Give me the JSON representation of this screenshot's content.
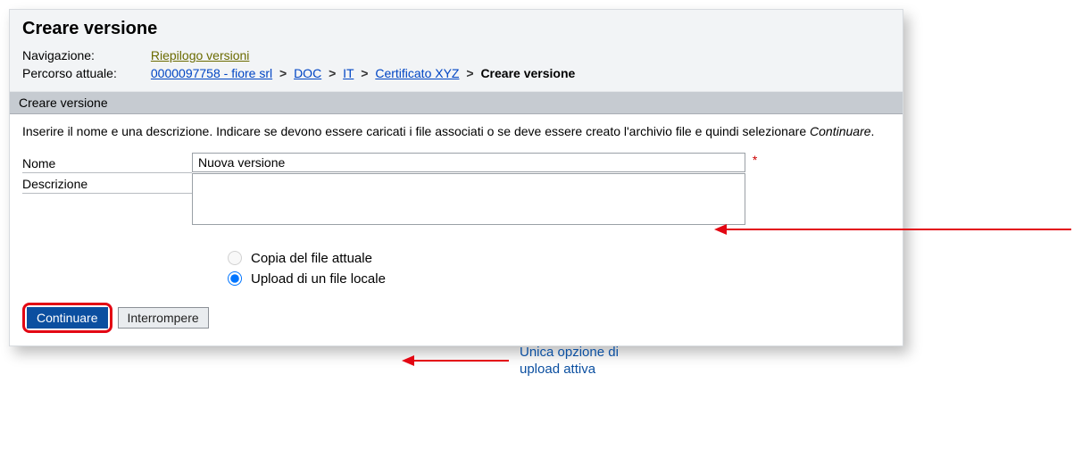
{
  "header": {
    "title": "Creare versione",
    "nav_label": "Navigazione:",
    "nav_link": "Riepilogo versioni",
    "path_label": "Percorso attuale:",
    "crumbs": {
      "c0": "0000097758 - fiore srl",
      "c1": "DOC",
      "c2": "IT",
      "c3": "Certificato XYZ",
      "current": "Creare versione"
    }
  },
  "section": {
    "bar": "Creare versione",
    "intro_a": "Inserire il nome e una descrizione. Indicare se devono essere caricati i file associati o se deve essere creato l'archivio file e quindi selezionare ",
    "intro_b": "Continuare",
    "intro_c": "."
  },
  "form": {
    "name_label": "Nome",
    "name_value": "Nuova versione",
    "desc_label": "Descrizione",
    "desc_value": "",
    "req_mark": "*"
  },
  "options": {
    "opt_copy": "Copia del file attuale",
    "opt_upload": "Upload di un file locale"
  },
  "buttons": {
    "continue": "Continuare",
    "cancel": "Interrompere"
  },
  "annotations": {
    "upload_note": "Unica opzione di\nupload attiva"
  }
}
